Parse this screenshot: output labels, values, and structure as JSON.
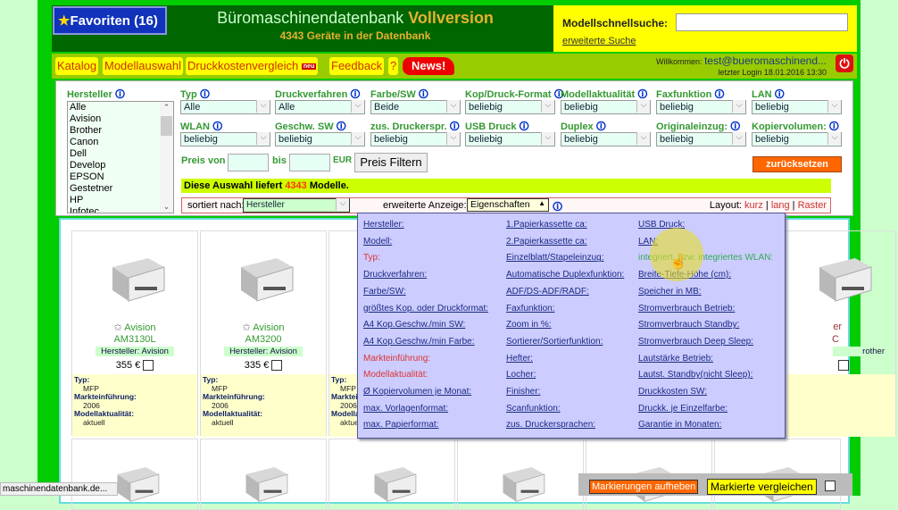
{
  "header": {
    "favorites": "Favoriten (16)",
    "title": "Büromaschinendatenbank",
    "title_accent": "Vollversion",
    "subtitle": "4343 Geräte in der Datenbank"
  },
  "quicksearch": {
    "label": "Modellschnellsuche:",
    "value": "",
    "advanced": "erweiterte Suche"
  },
  "menu": {
    "items": [
      "Katalog",
      "Modellauswahl",
      "Druckkostenvergleich",
      "Feedback",
      "?"
    ],
    "neu": "neu",
    "news": "News!",
    "welcome_label": "Willkommen:",
    "user": "test@bueromaschinend...",
    "last_login": "letzter Login 18.01.2016 13:30"
  },
  "filters": {
    "hersteller_label": "Hersteller",
    "hersteller_list": [
      "Alle",
      "Avision",
      "Brother",
      "Canon",
      "Dell",
      "Develop",
      "EPSON",
      "Gestetner",
      "HP",
      "Infotec"
    ],
    "row1": [
      {
        "label": "Typ",
        "value": "Alle"
      },
      {
        "label": "Druckverfahren",
        "value": "Alle"
      },
      {
        "label": "Farbe/SW",
        "value": "Beide"
      },
      {
        "label": "Kop/Druck-Format",
        "value": "beliebig"
      },
      {
        "label": "Modellaktualität",
        "value": "beliebig"
      },
      {
        "label": "Faxfunktion",
        "value": "beliebig"
      },
      {
        "label": "LAN",
        "value": "beliebig"
      }
    ],
    "row2": [
      {
        "label": "WLAN",
        "value": "beliebig"
      },
      {
        "label": "Geschw. SW",
        "value": "beliebig"
      },
      {
        "label": "zus. Druckerspr.",
        "value": "beliebig"
      },
      {
        "label": "USB Druck",
        "value": "beliebig"
      },
      {
        "label": "Duplex",
        "value": "beliebig"
      },
      {
        "label": "Originaleinzug:",
        "value": "beliebig"
      },
      {
        "label": "Kopiervolumen:",
        "value": "beliebig"
      }
    ],
    "price_from": "Preis von",
    "price_to": "bis",
    "currency": "EUR",
    "price_button": "Preis Filtern",
    "reset": "zurücksetzen",
    "result_pre": "Diese Auswahl liefert",
    "result_count": "4343",
    "result_post": "Modelle.",
    "sort_label": "sortiert nach:",
    "sort_value": "Hersteller",
    "ext_label": "erweiterte Anzeige:",
    "ext_value": "Eigenschaften",
    "layout_label": "Layout:",
    "layout_options": [
      "kurz",
      "lang",
      "Raster"
    ]
  },
  "popup": {
    "col1": [
      "Hersteller:",
      "Modell:",
      "Typ:",
      "Druckverfahren:",
      "Farbe/SW:",
      "größtes Kop. oder Druckformat:",
      "A4 Kop.Geschw./min SW:",
      "A4 Kop.Geschw./min Farbe:",
      "Markteinführung:",
      "Modellaktualität:",
      "Ø Kopiervolumen je Monat:",
      "max. Vorlagenformat:",
      "max. Papierformat:"
    ],
    "col2": [
      "1.Papierkassette ca:",
      "2.Papierkassette ca:",
      "Einzelblatt/Stapeleinzug:",
      "Automatische Duplexfunktion:",
      "ADF/DS-ADF/RADF:",
      "Faxfunktion:",
      "Zoom in %:",
      "Sortierer/Sortierfunktion:",
      "Hefter:",
      "Locher:",
      "Finisher:",
      "Scanfunktion:",
      "zus. Druckersprachen:"
    ],
    "col3": [
      "USB Druck:",
      "LAN:",
      "integriert, bzw. integriertes WLAN:",
      "Breite-Tiefe-Höhe (cm):",
      "Speicher in MB:",
      "Stromverbrauch Betrieb:",
      "Stromverbrauch Standby:",
      "Stromverbrauch Deep Sleep:",
      "Lautstärke Betrieb:",
      "Lautst. Standby(nicht Sleep):",
      "Druckkosten SW:",
      "Druckk. je Einzelfarbe:",
      "Garantie in Monaten:"
    ],
    "selected_red": [
      "Typ:",
      "Markteinführung:",
      "Modellaktualität:"
    ],
    "hovered": "integriert, bzw. integriertes WLAN:"
  },
  "products": [
    {
      "brand": "Avision",
      "model": "AM3130L",
      "hersteller": "Hersteller: Avision",
      "price": "355 €",
      "typ_label": "Typ:",
      "typ": "MFP",
      "mk_label": "Markteinführung:",
      "mk": "2006",
      "ma_label": "Modellaktualität:",
      "ma": "aktuell"
    },
    {
      "brand": "Avision",
      "model": "AM3200",
      "hersteller": "Hersteller: Avision",
      "price": "335 €",
      "typ_label": "Typ:",
      "typ": "MFP",
      "mk_label": "Markteinführung:",
      "mk": "2006",
      "ma_label": "Modellaktualität:",
      "ma": "aktuell"
    },
    {
      "typ_label": "Typ:",
      "typ": "MFP",
      "mk_label": "Marktei",
      "mk": "2006",
      "ma_label": "Modella",
      "ma": "aktue"
    },
    {
      "brand": "er",
      "model": "C",
      "hersteller": "rother"
    }
  ],
  "compare": {
    "clear": "Markierungen aufheben",
    "compare": "Markierte vergleichen"
  },
  "statusbar": "maschinendatenbank.de..."
}
